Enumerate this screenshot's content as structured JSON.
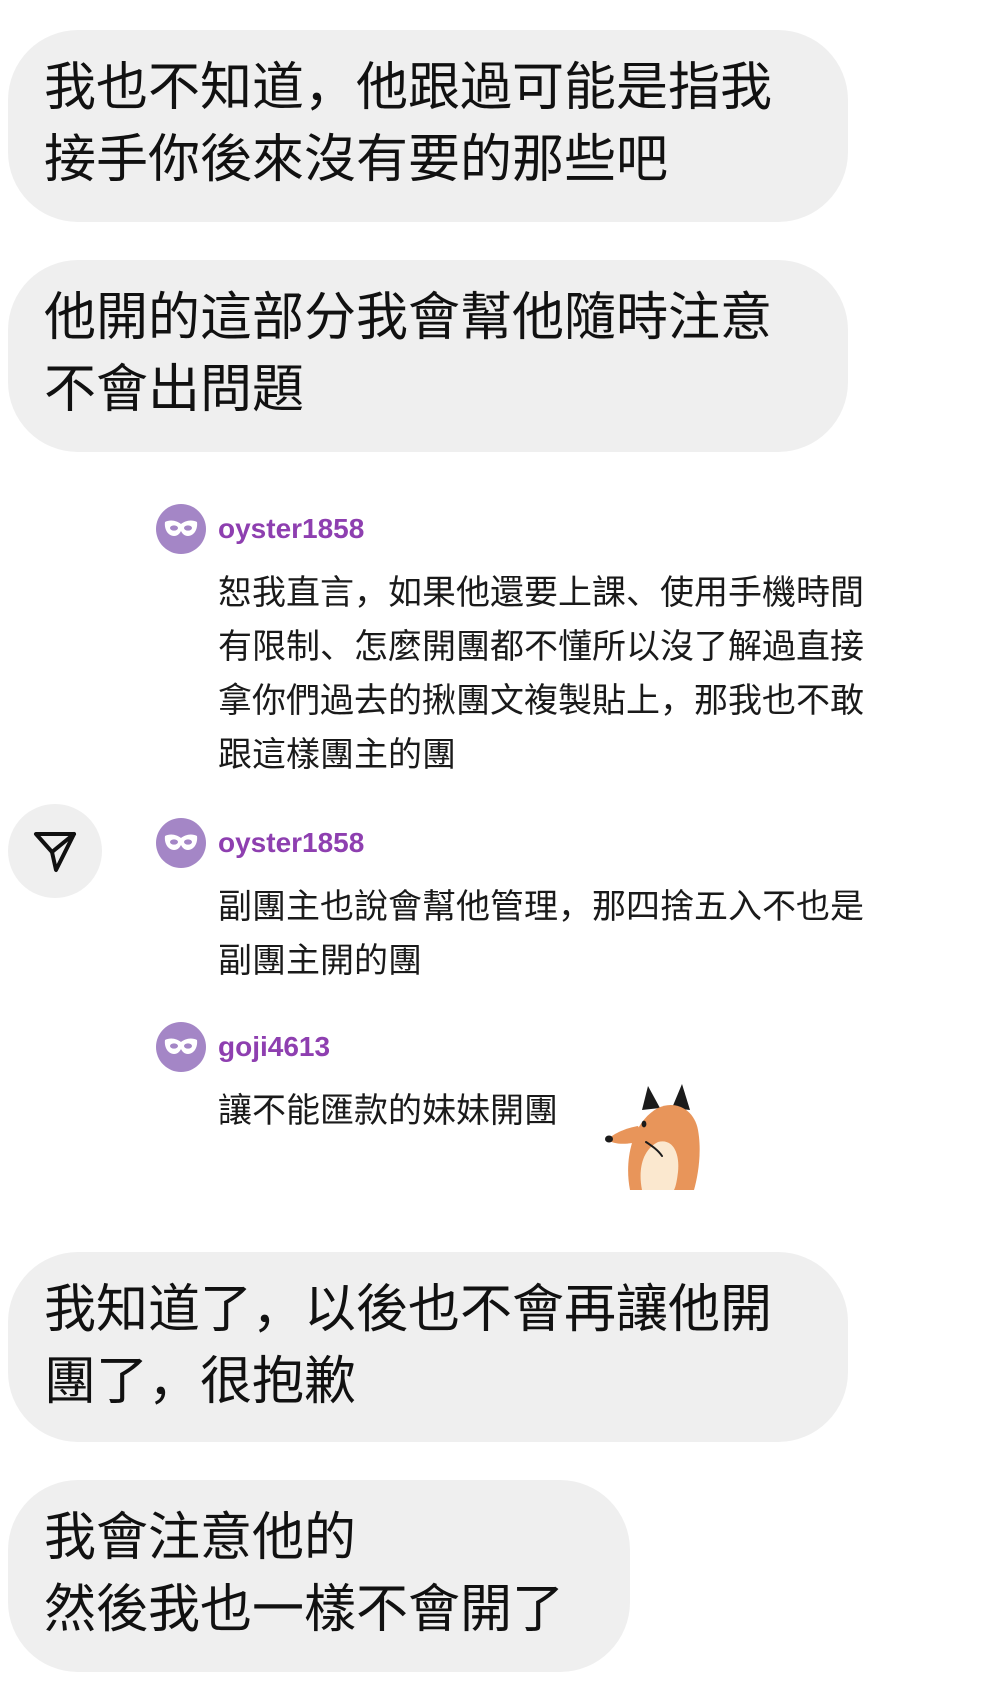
{
  "messages": [
    {
      "lines": [
        "我也不知道，他跟過可能是指我",
        "接手你後來沒有要的那些吧"
      ]
    },
    {
      "lines": [
        "他開的這部分我會幫他隨時注意",
        "不會出問題"
      ]
    },
    {
      "lines": [
        "我知道了，以後也不會再讓他開",
        "團了，很抱歉"
      ]
    },
    {
      "lines": [
        "我會注意他的",
        "然後我也一樣不會開了"
      ]
    }
  ],
  "shared_post": {
    "share_icon": "send-paper-plane-icon",
    "comments": [
      {
        "username": "oyster1858",
        "avatar_icon": "mask-icon",
        "lines": [
          "恕我直言，如果他還要上課、使用手機時間",
          "有限制、怎麼開團都不懂所以沒了解過直接",
          "拿你們過去的揪團文複製貼上，那我也不敢",
          "跟這樣團主的團"
        ]
      },
      {
        "username": "oyster1858",
        "avatar_icon": "mask-icon",
        "lines": [
          "副團主也說會幫他管理，那四捨五入不也是",
          "副團主開的團"
        ]
      },
      {
        "username": "goji4613",
        "avatar_icon": "mask-icon",
        "lines": [
          "讓不能匯款的妹妹開團"
        ],
        "sticker": "fox-sticker-icon"
      }
    ]
  },
  "colors": {
    "bubble_background": "#efefef",
    "username": "#8e3fb0",
    "avatar_background": "#a486c6",
    "text": "#111111"
  }
}
